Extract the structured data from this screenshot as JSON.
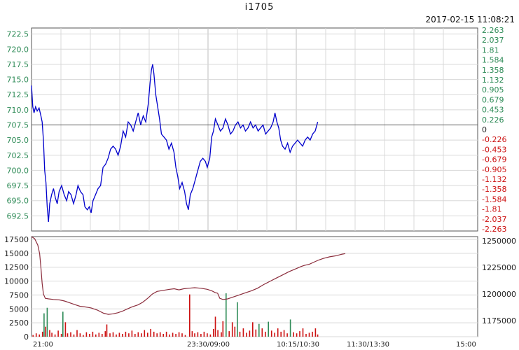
{
  "title": "i1705",
  "timestamp": "2017-02-15 11:08:21",
  "colors": {
    "price": "#0000cc",
    "avg": "#8b2d3c",
    "up_bar": "#2e8b57",
    "down_bar": "#cc1111",
    "pos_label": "#2e8b57",
    "neg_label": "#cc1111",
    "grid": "#d8d8d8",
    "axis": "#555555"
  },
  "chart_data": [
    {
      "type": "line",
      "name": "price",
      "x_ticks": [],
      "y_ticks": [
        "722.5",
        "720.0",
        "717.5",
        "715.0",
        "712.5",
        "710.0",
        "707.5",
        "705.0",
        "702.5",
        "700.0",
        "697.5",
        "695.0",
        "692.5"
      ],
      "ylim": [
        690,
        723.5
      ],
      "ref_value": 707.5,
      "right_ticks": [
        "2.263",
        "2.037",
        "1.81",
        "1.584",
        "1.358",
        "1.132",
        "0.905",
        "0.679",
        "0.453",
        "0.226",
        "0",
        "-0.226",
        "-0.453",
        "-0.679",
        "-0.905",
        "-1.132",
        "-1.358",
        "-1.584",
        "-1.81",
        "-2.037",
        "-2.263"
      ],
      "x_range": [
        0,
        100
      ],
      "points": [
        [
          0,
          714.0
        ],
        [
          0.4,
          710.5
        ],
        [
          0.8,
          709.5
        ],
        [
          1.3,
          710.5
        ],
        [
          1.8,
          709.8
        ],
        [
          2.4,
          710.3
        ],
        [
          3.0,
          709.0
        ],
        [
          3.4,
          708.0
        ],
        [
          3.8,
          705.0
        ],
        [
          4.2,
          700.0
        ],
        [
          4.6,
          698.0
        ],
        [
          5.0,
          694.0
        ],
        [
          5.4,
          691.5
        ],
        [
          5.8,
          694.5
        ],
        [
          6.4,
          696.0
        ],
        [
          7.0,
          697.0
        ],
        [
          7.6,
          695.5
        ],
        [
          8.2,
          694.5
        ],
        [
          8.8,
          696.5
        ],
        [
          9.6,
          697.5
        ],
        [
          10.4,
          696.0
        ],
        [
          11.2,
          695.0
        ],
        [
          11.8,
          696.5
        ],
        [
          12.6,
          696.0
        ],
        [
          13.4,
          694.5
        ],
        [
          14.2,
          696.0
        ],
        [
          14.8,
          697.5
        ],
        [
          15.6,
          696.5
        ],
        [
          16.4,
          696.0
        ],
        [
          17.0,
          694.0
        ],
        [
          17.8,
          693.5
        ],
        [
          18.4,
          694.0
        ],
        [
          19.0,
          693.0
        ],
        [
          19.6,
          695.0
        ],
        [
          20.4,
          696.0
        ],
        [
          21.2,
          697.0
        ],
        [
          22.0,
          697.5
        ],
        [
          22.8,
          700.5
        ],
        [
          23.6,
          701.0
        ],
        [
          24.4,
          702.0
        ],
        [
          25.2,
          703.5
        ],
        [
          26.0,
          704.0
        ],
        [
          26.8,
          703.5
        ],
        [
          27.6,
          702.5
        ],
        [
          28.4,
          704.0
        ],
        [
          29.2,
          706.5
        ],
        [
          30.0,
          705.5
        ],
        [
          30.8,
          708.0
        ],
        [
          31.6,
          707.5
        ],
        [
          32.4,
          706.5
        ],
        [
          33.2,
          708.0
        ],
        [
          34.0,
          709.5
        ],
        [
          34.8,
          707.5
        ],
        [
          35.6,
          709.0
        ],
        [
          36.4,
          708.0
        ],
        [
          37.2,
          711.0
        ],
        [
          37.8,
          714.5
        ],
        [
          38.2,
          716.5
        ],
        [
          38.6,
          717.5
        ],
        [
          39.0,
          716.0
        ],
        [
          39.6,
          712.5
        ],
        [
          40.2,
          710.5
        ],
        [
          40.8,
          708.5
        ],
        [
          41.4,
          706.0
        ],
        [
          42.2,
          705.5
        ],
        [
          43.0,
          705.0
        ],
        [
          43.8,
          703.5
        ],
        [
          44.6,
          704.5
        ],
        [
          45.4,
          703.0
        ],
        [
          46.0,
          700.5
        ],
        [
          46.6,
          699.0
        ],
        [
          47.2,
          697.0
        ],
        [
          48.0,
          698.0
        ],
        [
          48.8,
          696.5
        ],
        [
          49.4,
          694.5
        ],
        [
          50.0,
          693.5
        ],
        [
          50.6,
          696.0
        ],
        [
          51.4,
          697.0
        ],
        [
          52.2,
          698.5
        ],
        [
          53.0,
          700.0
        ],
        [
          53.8,
          701.5
        ],
        [
          54.6,
          702.0
        ],
        [
          55.4,
          701.5
        ],
        [
          56.0,
          700.5
        ],
        [
          56.8,
          702.0
        ],
        [
          57.4,
          705.5
        ],
        [
          58.0,
          706.5
        ],
        [
          58.6,
          708.5
        ],
        [
          59.4,
          707.5
        ],
        [
          60.2,
          706.5
        ],
        [
          61.0,
          707.0
        ],
        [
          61.8,
          708.5
        ],
        [
          62.6,
          707.5
        ],
        [
          63.4,
          706.0
        ],
        [
          64.2,
          706.5
        ],
        [
          65.0,
          707.5
        ],
        [
          65.8,
          708.0
        ],
        [
          66.6,
          707.0
        ],
        [
          67.4,
          707.5
        ],
        [
          68.2,
          706.5
        ],
        [
          69.0,
          707.0
        ],
        [
          69.8,
          708.0
        ],
        [
          70.6,
          707.0
        ],
        [
          71.4,
          707.5
        ],
        [
          72.2,
          706.5
        ],
        [
          73.0,
          707.0
        ],
        [
          73.8,
          707.5
        ],
        [
          74.6,
          706.0
        ],
        [
          75.4,
          706.5
        ],
        [
          76.2,
          707.0
        ],
        [
          77.0,
          708.0
        ],
        [
          77.6,
          709.5
        ],
        [
          78.2,
          708.0
        ],
        [
          78.8,
          707.0
        ],
        [
          79.4,
          705.0
        ],
        [
          80.0,
          704.0
        ],
        [
          80.8,
          703.5
        ],
        [
          81.6,
          704.5
        ],
        [
          82.4,
          703.0
        ],
        [
          83.2,
          704.0
        ],
        [
          84.0,
          704.5
        ],
        [
          84.8,
          705.0
        ],
        [
          85.6,
          704.5
        ],
        [
          86.4,
          704.0
        ],
        [
          87.2,
          705.0
        ],
        [
          88.0,
          705.5
        ],
        [
          88.8,
          705.0
        ],
        [
          89.6,
          706.0
        ],
        [
          90.4,
          706.5
        ],
        [
          91.2,
          708.0
        ]
      ]
    },
    {
      "type": "bar",
      "name": "volume",
      "y_ticks": [
        "17500",
        "15000",
        "12500",
        "10000",
        "7500",
        "5000",
        "2500",
        "0"
      ],
      "ylim": [
        0,
        18000
      ],
      "right_ticks": [
        "1250000",
        "1225000",
        "1200000",
        "1175000"
      ],
      "right_ylim": [
        1160000,
        1254000
      ],
      "x_ticks": [
        "21:00",
        "23:30/09:00",
        "10:15/10:30",
        "11:30/13:30",
        "15:00"
      ],
      "bars": [
        [
          0.5,
          300,
          "down"
        ],
        [
          1.5,
          600,
          "down"
        ],
        [
          2.5,
          400,
          "down"
        ],
        [
          3.5,
          900,
          "down"
        ],
        [
          4.0,
          4200,
          "up"
        ],
        [
          4.5,
          1800,
          "down"
        ],
        [
          5.0,
          5200,
          "up"
        ],
        [
          5.8,
          1200,
          "down"
        ],
        [
          6.5,
          700,
          "down"
        ],
        [
          7.5,
          400,
          "down"
        ],
        [
          8.5,
          1100,
          "down"
        ],
        [
          9.5,
          500,
          "down"
        ],
        [
          10.0,
          4500,
          "up"
        ],
        [
          10.8,
          2600,
          "down"
        ],
        [
          11.5,
          600,
          "down"
        ],
        [
          12.5,
          800,
          "down"
        ],
        [
          13.5,
          400,
          "down"
        ],
        [
          14.5,
          1200,
          "down"
        ],
        [
          15.5,
          600,
          "down"
        ],
        [
          16.5,
          300,
          "down"
        ],
        [
          17.5,
          800,
          "down"
        ],
        [
          18.5,
          500,
          "down"
        ],
        [
          19.5,
          900,
          "down"
        ],
        [
          20.5,
          400,
          "down"
        ],
        [
          21.5,
          700,
          "down"
        ],
        [
          22.5,
          500,
          "down"
        ],
        [
          23.5,
          1000,
          "down"
        ],
        [
          24.0,
          2200,
          "down"
        ],
        [
          25.0,
          600,
          "down"
        ],
        [
          26.0,
          800,
          "down"
        ],
        [
          27.0,
          400,
          "down"
        ],
        [
          28.0,
          700,
          "down"
        ],
        [
          29.0,
          500,
          "down"
        ],
        [
          30.0,
          900,
          "down"
        ],
        [
          31.0,
          600,
          "down"
        ],
        [
          32.0,
          1100,
          "down"
        ],
        [
          33.0,
          500,
          "down"
        ],
        [
          34.0,
          800,
          "down"
        ],
        [
          35.0,
          600,
          "down"
        ],
        [
          36.0,
          1200,
          "down"
        ],
        [
          37.0,
          700,
          "down"
        ],
        [
          38.0,
          1400,
          "down"
        ],
        [
          39.0,
          900,
          "down"
        ],
        [
          40.0,
          600,
          "down"
        ],
        [
          41.0,
          800,
          "down"
        ],
        [
          42.0,
          500,
          "down"
        ],
        [
          43.0,
          900,
          "down"
        ],
        [
          44.0,
          400,
          "down"
        ],
        [
          45.0,
          700,
          "down"
        ],
        [
          46.0,
          500,
          "down"
        ],
        [
          47.0,
          800,
          "down"
        ],
        [
          48.0,
          600,
          "down"
        ],
        [
          49.0,
          300,
          "down"
        ],
        [
          50.4,
          7600,
          "down"
        ],
        [
          51.2,
          1000,
          "down"
        ],
        [
          52.0,
          600,
          "down"
        ],
        [
          53.0,
          800,
          "down"
        ],
        [
          54.0,
          500,
          "down"
        ],
        [
          55.0,
          900,
          "down"
        ],
        [
          56.0,
          600,
          "down"
        ],
        [
          57.0,
          400,
          "down"
        ],
        [
          58.0,
          1400,
          "down"
        ],
        [
          58.6,
          3600,
          "down"
        ],
        [
          59.4,
          1200,
          "down"
        ],
        [
          60.5,
          800,
          "down"
        ],
        [
          61.0,
          2800,
          "down"
        ],
        [
          62.0,
          7800,
          "up"
        ],
        [
          63.0,
          1000,
          "down"
        ],
        [
          64.0,
          2600,
          "down"
        ],
        [
          64.8,
          1800,
          "down"
        ],
        [
          65.6,
          6200,
          "up"
        ],
        [
          66.4,
          900,
          "down"
        ],
        [
          67.5,
          1500,
          "down"
        ],
        [
          68.5,
          700,
          "down"
        ],
        [
          69.5,
          1100,
          "down"
        ],
        [
          70.5,
          2600,
          "down"
        ],
        [
          71.5,
          1300,
          "down"
        ],
        [
          72.5,
          2300,
          "up"
        ],
        [
          73.5,
          1500,
          "down"
        ],
        [
          74.5,
          900,
          "down"
        ],
        [
          75.5,
          2700,
          "up"
        ],
        [
          76.5,
          1100,
          "down"
        ],
        [
          77.5,
          700,
          "down"
        ],
        [
          78.5,
          1500,
          "down"
        ],
        [
          79.5,
          900,
          "down"
        ],
        [
          80.5,
          1200,
          "down"
        ],
        [
          81.5,
          600,
          "down"
        ],
        [
          82.5,
          3100,
          "up"
        ],
        [
          83.5,
          800,
          "down"
        ],
        [
          84.5,
          600,
          "down"
        ],
        [
          85.5,
          1000,
          "down"
        ],
        [
          86.5,
          1500,
          "down"
        ],
        [
          87.5,
          500,
          "down"
        ],
        [
          88.5,
          700,
          "down"
        ],
        [
          89.5,
          900,
          "down"
        ],
        [
          90.5,
          1500,
          "down"
        ],
        [
          91.2,
          400,
          "down"
        ]
      ],
      "cumulative": [
        [
          0,
          1254000
        ],
        [
          1.0,
          1252000
        ],
        [
          2.0,
          1246000
        ],
        [
          2.6,
          1238000
        ],
        [
          3.0,
          1225000
        ],
        [
          3.4,
          1210000
        ],
        [
          3.8,
          1200000
        ],
        [
          4.4,
          1196000
        ],
        [
          5.5,
          1195500
        ],
        [
          7.0,
          1195000
        ],
        [
          9.0,
          1194500
        ],
        [
          10.5,
          1193500
        ],
        [
          12.0,
          1192000
        ],
        [
          14.0,
          1190000
        ],
        [
          15.5,
          1188500
        ],
        [
          17.0,
          1188000
        ],
        [
          19.0,
          1187000
        ],
        [
          21.0,
          1185000
        ],
        [
          23.0,
          1182000
        ],
        [
          24.5,
          1181000
        ],
        [
          26.0,
          1181500
        ],
        [
          27.5,
          1182500
        ],
        [
          29.0,
          1184000
        ],
        [
          30.5,
          1186000
        ],
        [
          32.0,
          1188000
        ],
        [
          34.0,
          1190000
        ],
        [
          35.5,
          1192500
        ],
        [
          37.0,
          1196000
        ],
        [
          38.5,
          1200000
        ],
        [
          40.0,
          1202500
        ],
        [
          42.0,
          1203500
        ],
        [
          44.0,
          1204500
        ],
        [
          45.5,
          1205000
        ],
        [
          47.0,
          1204000
        ],
        [
          48.5,
          1205000
        ],
        [
          50.0,
          1205500
        ],
        [
          52.0,
          1206000
        ],
        [
          54.0,
          1205500
        ],
        [
          56.0,
          1204500
        ],
        [
          57.5,
          1203000
        ],
        [
          58.5,
          1201500
        ],
        [
          59.3,
          1200800
        ],
        [
          60.0,
          1196000
        ],
        [
          61.0,
          1195000
        ],
        [
          62.5,
          1195500
        ],
        [
          64.0,
          1197000
        ],
        [
          66.0,
          1199000
        ],
        [
          68.0,
          1201000
        ],
        [
          70.0,
          1203000
        ],
        [
          72.0,
          1205500
        ],
        [
          74.0,
          1209000
        ],
        [
          76.0,
          1212000
        ],
        [
          78.0,
          1215000
        ],
        [
          80.0,
          1218000
        ],
        [
          82.0,
          1221000
        ],
        [
          84.0,
          1223500
        ],
        [
          86.0,
          1226000
        ],
        [
          87.0,
          1227000
        ],
        [
          88.5,
          1228000
        ],
        [
          90.0,
          1230000
        ],
        [
          91.5,
          1232000
        ],
        [
          93.0,
          1233500
        ],
        [
          95.0,
          1235000
        ],
        [
          97.0,
          1236000
        ],
        [
          99.0,
          1237500
        ],
        [
          100,
          1238000
        ]
      ]
    }
  ]
}
